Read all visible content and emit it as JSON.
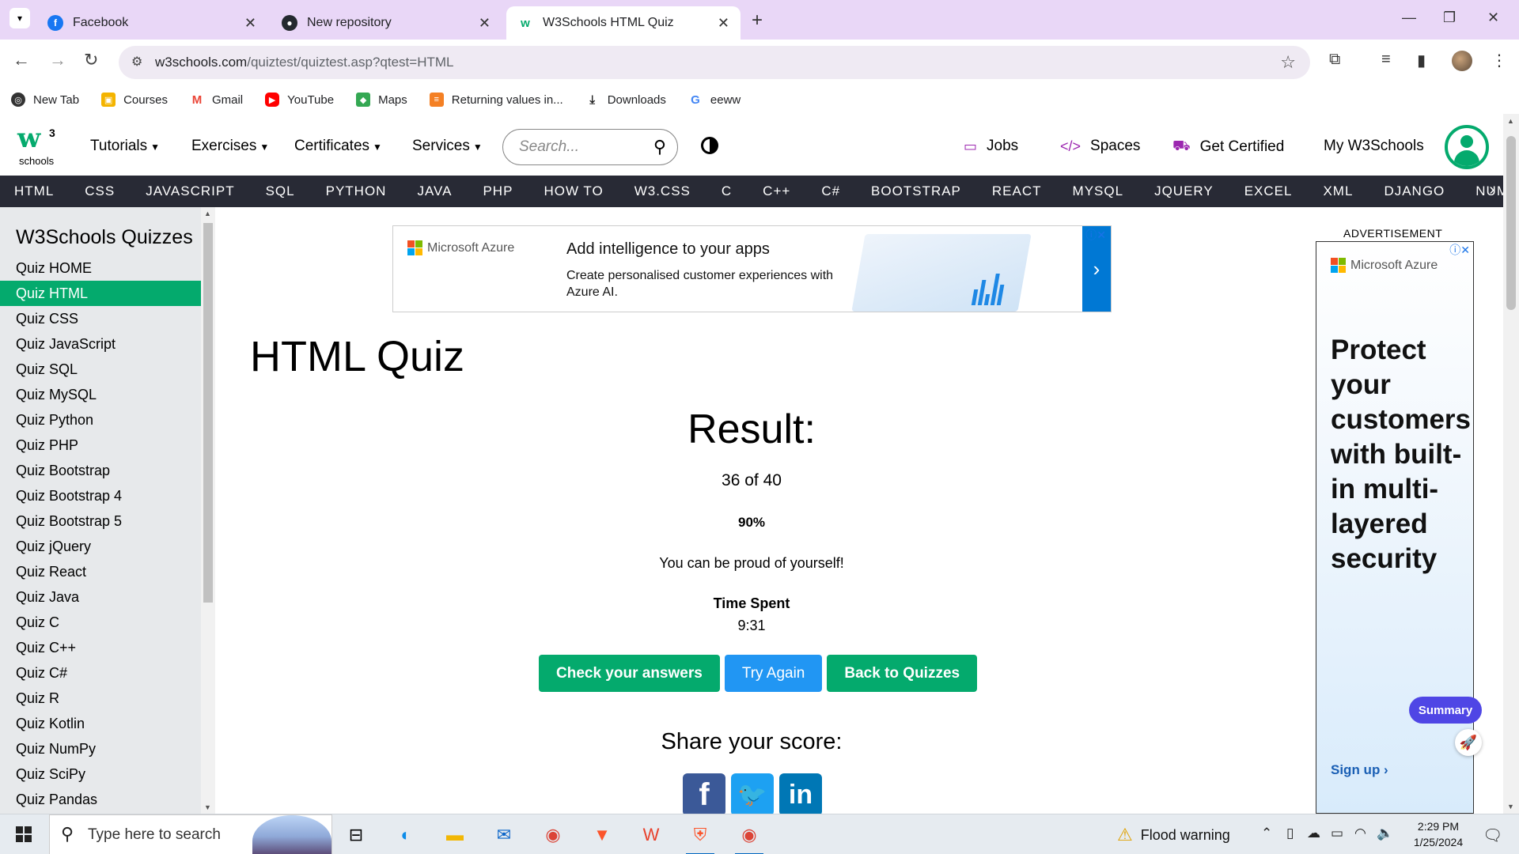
{
  "browser": {
    "tabs": [
      {
        "title": "Facebook",
        "active": false
      },
      {
        "title": "New repository",
        "active": false
      },
      {
        "title": "W3Schools HTML Quiz",
        "active": true
      }
    ],
    "url_host": "w3schools.com",
    "url_path": "/quiztest/quiztest.asp?qtest=HTML",
    "bookmarks": [
      "New Tab",
      "Courses",
      "Gmail",
      "YouTube",
      "Maps",
      "Returning values in...",
      "Downloads",
      "eeww"
    ]
  },
  "header": {
    "logo_text": "w",
    "logo_sup": "3",
    "logo_sub": "schools",
    "menu": [
      "Tutorials",
      "Exercises",
      "Certificates",
      "Services"
    ],
    "search_placeholder": "Search...",
    "right": [
      "Jobs",
      "Spaces",
      "Get Certified",
      "My W3Schools"
    ]
  },
  "topics": [
    "HTML",
    "CSS",
    "JAVASCRIPT",
    "SQL",
    "PYTHON",
    "JAVA",
    "PHP",
    "HOW TO",
    "W3.CSS",
    "C",
    "C++",
    "C#",
    "BOOTSTRAP",
    "REACT",
    "MYSQL",
    "JQUERY",
    "EXCEL",
    "XML",
    "DJANGO",
    "NUMPY"
  ],
  "sidebar": {
    "title": "W3Schools Quizzes",
    "items": [
      "Quiz HOME",
      "Quiz HTML",
      "Quiz CSS",
      "Quiz JavaScript",
      "Quiz SQL",
      "Quiz MySQL",
      "Quiz Python",
      "Quiz PHP",
      "Quiz Bootstrap",
      "Quiz Bootstrap 4",
      "Quiz Bootstrap 5",
      "Quiz jQuery",
      "Quiz React",
      "Quiz Java",
      "Quiz C",
      "Quiz C++",
      "Quiz C#",
      "Quiz R",
      "Quiz Kotlin",
      "Quiz NumPy",
      "Quiz SciPy",
      "Quiz Pandas"
    ],
    "active_index": 1
  },
  "ad_top": {
    "brand": "Microsoft Azure",
    "headline": "Add intelligence to your apps",
    "body": "Create personalised customer experiences with Azure AI."
  },
  "main": {
    "page_title": "HTML Quiz",
    "result_heading": "Result:",
    "score": "36 of 40",
    "percent": "90%",
    "message": "You can be proud of yourself!",
    "time_label": "Time Spent",
    "time_value": "9:31",
    "buttons": {
      "check": "Check your answers",
      "retry": "Try Again",
      "back": "Back to Quizzes"
    },
    "share_heading": "Share your score:"
  },
  "ad_right": {
    "label": "ADVERTISEMENT",
    "brand": "Microsoft Azure",
    "copy": "Protect your customers with built-in multi-layered security",
    "cta": "Sign up ›",
    "summary": "Summary"
  },
  "taskbar": {
    "search_placeholder": "Type here to search",
    "weather": "Flood warning",
    "time": "2:29 PM",
    "date": "1/25/2024"
  },
  "colors": {
    "w3_green": "#04aa6d",
    "topbar_dark": "#282a35",
    "retry_blue": "#2196f3",
    "tab_strip": "#e9d7f7"
  }
}
